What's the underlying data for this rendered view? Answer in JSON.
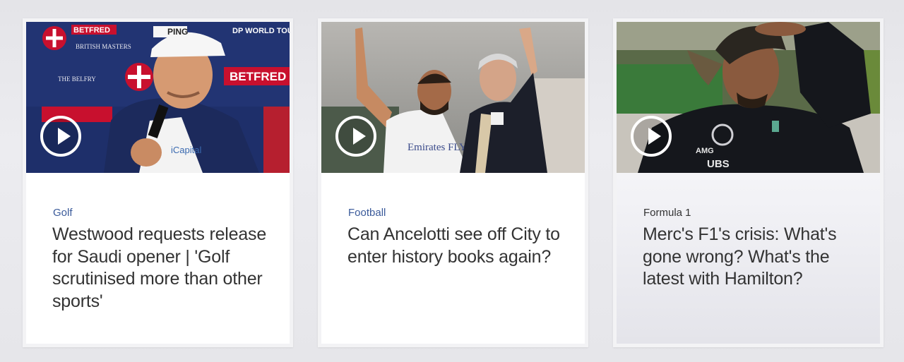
{
  "cards": [
    {
      "category": "Golf",
      "headline": "Westwood requests release for Saudi opener | 'Golf scrutinised more than other sports'",
      "image": {
        "signs": [
          "BETFRED",
          "BRITISH MASTERS",
          "DP WORLD TOUR",
          "THE BELFRY",
          "BETFRED",
          "PING",
          "iCapital"
        ]
      }
    },
    {
      "category": "Football",
      "headline": "Can Ancelotti see off City to enter history books again?",
      "image": {
        "signs": [
          "Emirates FLY BETTER"
        ]
      }
    },
    {
      "category": "Formula 1",
      "headline": "Merc's F1's crisis: What's gone wrong? What's the latest with Hamilton?",
      "image": {
        "signs": [
          "UBS",
          "AMG"
        ]
      }
    }
  ],
  "colors": {
    "category_link": "#3a5a9a",
    "headline": "#333333",
    "card_bg": "#ffffff"
  },
  "icons": {
    "play": "play-circle-icon"
  }
}
